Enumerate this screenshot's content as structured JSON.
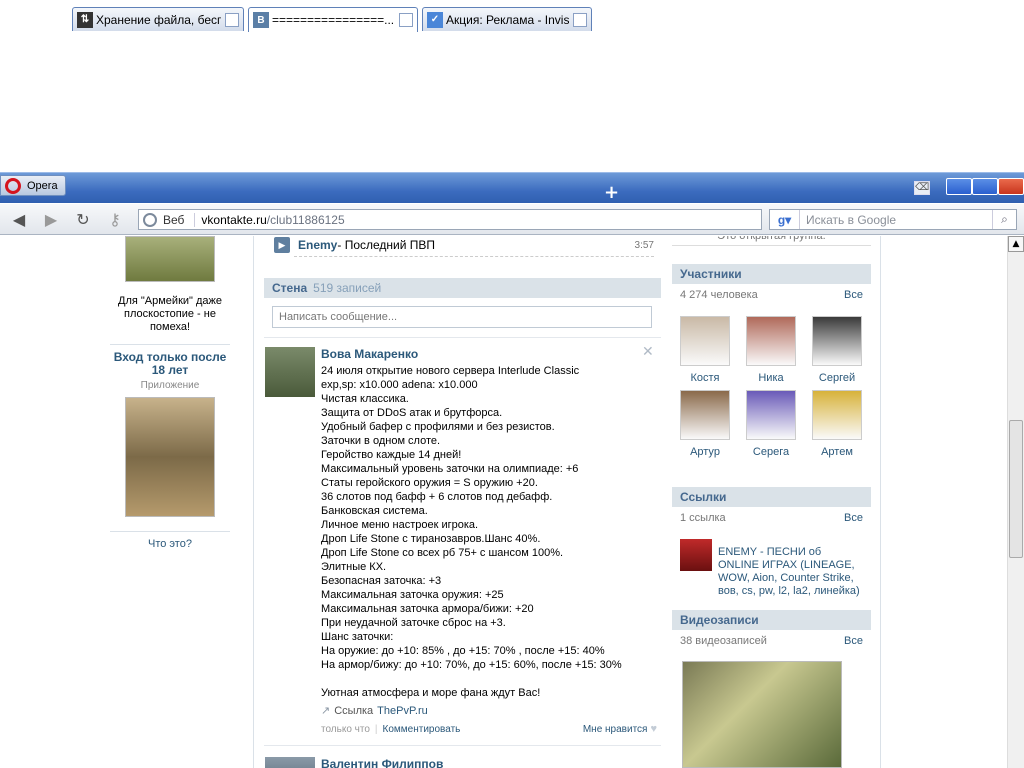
{
  "browser": {
    "opera_label": "Opera",
    "tabs": [
      {
        "title": "Хранение файла, беспл...",
        "icon": "transfer-icon"
      },
      {
        "title": "================...",
        "icon": "vk-icon"
      },
      {
        "title": "Акция: Реклама - Invisi...",
        "icon": "checkmark-icon"
      }
    ],
    "new_tab_symbol": "+",
    "address": {
      "web_label": "Веб",
      "host": "vkontakte.ru",
      "path": "/club11886125"
    },
    "search_placeholder": "Искать в Google"
  },
  "left_column": {
    "caption1": "Для \"Армейки\" даже плоскостопие - не помеха!",
    "app_title": "Вход только после 18 лет",
    "app_sub": "Приложение",
    "what_link": "Что это?"
  },
  "audio": {
    "artist": "Enemy",
    "title": " - Последний ПВП",
    "duration": "3:57"
  },
  "wall": {
    "title": "Стена",
    "count": "519 записей",
    "input_placeholder": "Написать сообщение...",
    "post": {
      "author": "Вова Макаренко",
      "lines": [
        "24 июля открытие нового сервера Interlude Classic",
        "exp,sp: x10.000 adena: x10.000",
        "Чистая классика.",
        "Защита от DDoS атак и брутфорса.",
        "Удобный бафер с профилями и без резистов.",
        "Заточки в одном слоте.",
        "Геройство каждые 14 дней!",
        "Максимальный уровень заточки на олимпиаде: +6",
        "Статы геройского оружия = S оружию +20.",
        "36 слотов под бафф + 6 слотов под дебафф.",
        "Банковская система.",
        "Личное меню настроек игрока.",
        "Дроп Life Stone с тиранозавров.Шанс 40%.",
        "Дроп Life Stone со всех рб 75+ с шансом 100%.",
        "Элитные КХ.",
        "Безопасная заточка: +3",
        "Максимальная заточка оружия: +25",
        "Максимальная заточка армора/бижи: +20",
        "При неудачной заточке сброс на +3.",
        "Шанс заточки:",
        "На оружие: до +10: 85% , до +15: 70% , после +15: 40%",
        "На армор/бижу: до +10: 70%, до +15: 60%, после +15: 30%",
        "",
        "Уютная атмосфера и море фана ждут Вас!"
      ],
      "link_prefix": "Ссылка",
      "link_text": "ThePvP.ru",
      "time": "только что",
      "comment_label": "Комментировать",
      "like_label": "Мне нравится"
    },
    "next_author": "Валентин Филиппов"
  },
  "right_column": {
    "group_type": "Это открытая группа.",
    "members": {
      "title": "Участники",
      "count": "4 274 человека",
      "all": "Все",
      "people": [
        {
          "name": "Костя",
          "color": "#c9b9a6"
        },
        {
          "name": "Ника",
          "color": "#b06a5a"
        },
        {
          "name": "Сергей",
          "color": "#3a3a3a"
        },
        {
          "name": "Артур",
          "color": "#8a6a4a"
        },
        {
          "name": "Серега",
          "color": "#6a5ab8"
        },
        {
          "name": "Артем",
          "color": "#d7b23a"
        }
      ]
    },
    "links": {
      "title": "Ссылки",
      "count": "1 ссылка",
      "all": "Все",
      "item": "ENEMY - ПЕСНИ об ONLINE ИГРАХ (LINEAGE, WOW, Aion, Counter Strike, вов, cs, pw, l2, la2, линейка)"
    },
    "videos": {
      "title": "Видеозаписи",
      "count": "38 видеозаписей",
      "all": "Все"
    }
  },
  "colors": {
    "vk_link": "#2b587a",
    "vk_header": "#45688e",
    "block_bg": "#dae2e8"
  }
}
